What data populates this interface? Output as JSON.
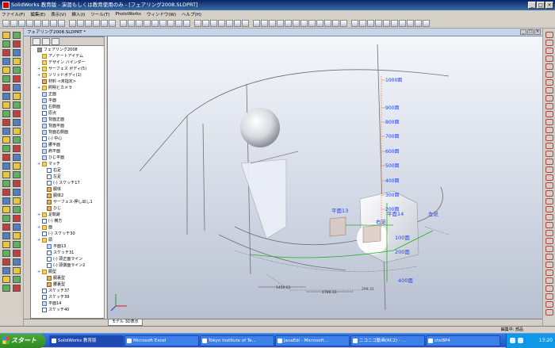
{
  "window": {
    "title": "SolidWorks 教育版 - 演習もしくは教育使用のみ - [フェアリング2008.SLDPRT]"
  },
  "menu": [
    "ファイル(F)",
    "編集(E)",
    "表示(V)",
    "挿入(I)",
    "ツール(T)",
    "PhotoWorks",
    "ウィンドウ(W)",
    "ヘルプ(H)"
  ],
  "document": {
    "title": "フェアリング2008.SLDPRT *"
  },
  "feature_tree": [
    {
      "label": "フェアリング2008",
      "icon": "part-icon",
      "level": 0
    },
    {
      "label": "アノテートアイテム",
      "icon": "annotation-icon",
      "level": 1
    },
    {
      "label": "デザイン バインダー",
      "icon": "binder-icon",
      "level": 1
    },
    {
      "label": "サーフェス ボディ(5)",
      "icon": "folder-icon",
      "level": 1
    },
    {
      "label": "ソリッドボディ(1)",
      "icon": "folder-icon",
      "level": 1
    },
    {
      "label": "材料 <未指定>",
      "icon": "material-icon",
      "level": 1
    },
    {
      "label": "照明とカメラ",
      "icon": "folder-icon",
      "level": 1
    },
    {
      "label": "正面",
      "icon": "plane-icon",
      "level": 1
    },
    {
      "label": "平面",
      "icon": "plane-icon",
      "level": 1
    },
    {
      "label": "右側面",
      "icon": "plane-icon",
      "level": 1
    },
    {
      "label": "原点",
      "icon": "origin-icon",
      "level": 1
    },
    {
      "label": "背面正面",
      "icon": "plane-icon",
      "level": 1
    },
    {
      "label": "背面平面",
      "icon": "plane-icon",
      "level": 1
    },
    {
      "label": "背面右側面",
      "icon": "plane-icon",
      "level": 1
    },
    {
      "label": "(-) 中心",
      "icon": "sketch-icon",
      "level": 1
    },
    {
      "label": "腰平面",
      "icon": "plane-icon",
      "level": 1
    },
    {
      "label": "肩平面",
      "icon": "plane-icon",
      "level": 1
    },
    {
      "label": "ひじ平面",
      "icon": "plane-icon",
      "level": 1
    },
    {
      "label": "マッチ",
      "icon": "folder-icon",
      "level": 1
    },
    {
      "label": "右足",
      "icon": "sketch-icon",
      "level": 2
    },
    {
      "label": "左足",
      "icon": "sketch-icon",
      "level": 2
    },
    {
      "label": "(-) スケッチ17",
      "icon": "sketch-icon",
      "level": 2
    },
    {
      "label": "胴体",
      "icon": "feature-icon",
      "level": 2
    },
    {
      "label": "胴体2",
      "icon": "feature-icon",
      "level": 2
    },
    {
      "label": "サーフェス-押し出し1",
      "icon": "feature-icon",
      "level": 2
    },
    {
      "label": "ひじ",
      "icon": "feature-icon",
      "level": 2
    },
    {
      "label": "足軌跡",
      "icon": "folder-icon",
      "level": 1
    },
    {
      "label": "(-) 横方",
      "icon": "sketch-icon",
      "level": 1
    },
    {
      "label": "面",
      "icon": "folder-icon",
      "level": 1
    },
    {
      "label": "(-) スケッチ30",
      "icon": "sketch-icon",
      "level": 1
    },
    {
      "label": "頭",
      "icon": "folder-icon",
      "level": 1
    },
    {
      "label": "平面13",
      "icon": "plane-icon",
      "level": 2
    },
    {
      "label": "スケッチ31",
      "icon": "sketch-icon",
      "level": 2
    },
    {
      "label": "(-) 頭正面ライン",
      "icon": "sketch-icon",
      "level": 2
    },
    {
      "label": "(-) 頭側面ライン2",
      "icon": "sketch-icon",
      "level": 2
    },
    {
      "label": "胴型",
      "icon": "folder-icon",
      "level": 1
    },
    {
      "label": "胴裏型",
      "icon": "feature-icon",
      "level": 2
    },
    {
      "label": "腰裏型",
      "icon": "feature-icon",
      "level": 2
    },
    {
      "label": "スケッチ37",
      "icon": "sketch-icon",
      "level": 1
    },
    {
      "label": "スケッチ39",
      "icon": "sketch-icon",
      "level": 1
    },
    {
      "label": "平面14",
      "icon": "plane-icon",
      "level": 1
    },
    {
      "label": "スケッチ40",
      "icon": "sketch-icon",
      "level": 1
    }
  ],
  "viewport": {
    "height_labels": [
      "1000面",
      "900面",
      "800面",
      "700面",
      "600面",
      "500面",
      "400面",
      "300面",
      "200面"
    ],
    "annotations": {
      "plane13": "平面13",
      "plane14": "平面14",
      "right_foot": "右足",
      "left_foot": "左足",
      "section_100": "100面",
      "section_200": "200面",
      "section_400": "400面"
    },
    "dimensions": [
      "1450.01",
      "1780.33",
      "299.31"
    ]
  },
  "model_tab": "モデル 3D表示",
  "status": {
    "text": "編集中: 部品"
  },
  "taskbar": {
    "start_label": "スタート",
    "tasks": [
      "SolidWorks 教育版",
      "Microsoft Excel",
      "Tokyo Institute of Te...",
      "JavaEdi - Microsoft...",
      "ニコニコ動画(RC2) - ...",
      "ctsi8P4"
    ],
    "clock": "13:20"
  },
  "colors": {
    "title_bar": "#0a246a",
    "taskbar": "#1e54c8",
    "start_button": "#2e8a22",
    "dimension_orange": "#e08040",
    "sketch_green": "#20b020",
    "sketch_blue": "#2040ff"
  }
}
